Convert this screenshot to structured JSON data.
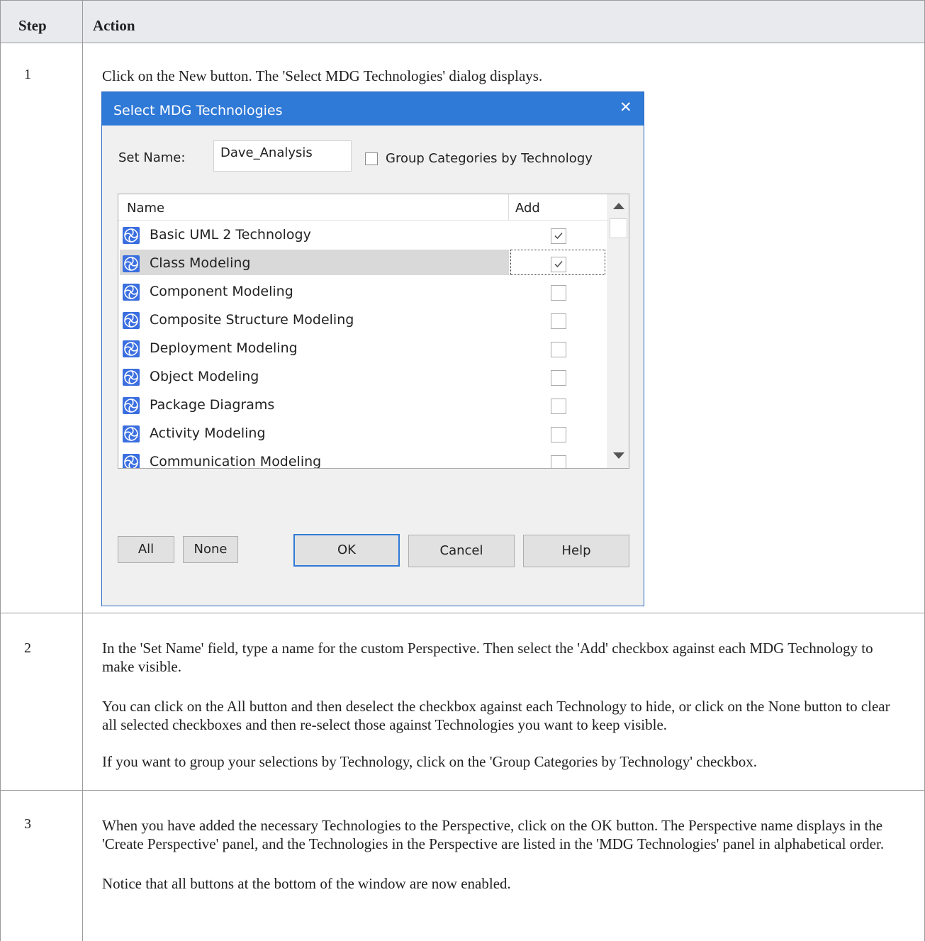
{
  "table": {
    "headers": {
      "step": "Step",
      "action": "Action"
    },
    "rows": [
      {
        "step": "1",
        "paragraphs": [
          "Click on the New button. The 'Select MDG Technologies' dialog displays."
        ]
      },
      {
        "step": "2",
        "paragraphs": [
          "In the 'Set Name' field, type a name for the custom Perspective. Then select the 'Add' checkbox against each MDG Technology to make visible.",
          "You can click on the All button and then deselect the checkbox against each Technology to hide, or click on the None button to clear all selected checkboxes and then re-select those against Technologies you want to keep visible.",
          "If you want to group your selections by Technology, click on the 'Group Categories by Technology' checkbox."
        ]
      },
      {
        "step": "3",
        "paragraphs": [
          "When you have added the necessary Technologies to the Perspective, click on the OK button. The Perspective name displays in the 'Create Perspective' panel, and the Technologies in the Perspective are listed in the 'MDG Technologies' panel in alphabetical order.",
          "Notice that all buttons at the bottom of the window are now enabled."
        ]
      }
    ]
  },
  "dialog": {
    "title": "Select MDG Technologies",
    "close_glyph": "✕",
    "set_name_label": "Set Name:",
    "set_name_value": "Dave_Analysis",
    "group_label": "Group Categories by Technology",
    "group_checked": false,
    "columns": {
      "name": "Name",
      "add": "Add"
    },
    "technologies": [
      {
        "name": "Basic UML 2 Technology",
        "checked": true,
        "selected": false
      },
      {
        "name": "Class Modeling",
        "checked": true,
        "selected": true
      },
      {
        "name": "Component Modeling",
        "checked": false,
        "selected": false
      },
      {
        "name": "Composite Structure Modeling",
        "checked": false,
        "selected": false
      },
      {
        "name": "Deployment Modeling",
        "checked": false,
        "selected": false
      },
      {
        "name": "Object Modeling",
        "checked": false,
        "selected": false
      },
      {
        "name": "Package Diagrams",
        "checked": false,
        "selected": false
      },
      {
        "name": "Activity Modeling",
        "checked": false,
        "selected": false
      },
      {
        "name": "Communication Modeling",
        "checked": false,
        "selected": false
      }
    ],
    "buttons": {
      "all": "All",
      "none": "None",
      "ok": "OK",
      "cancel": "Cancel",
      "help": "Help"
    }
  },
  "colors": {
    "titlebar": "#2f79d7",
    "header_bg": "#e8eaee",
    "selection": "#d9d9d9",
    "icon": "#3b6fe0"
  }
}
